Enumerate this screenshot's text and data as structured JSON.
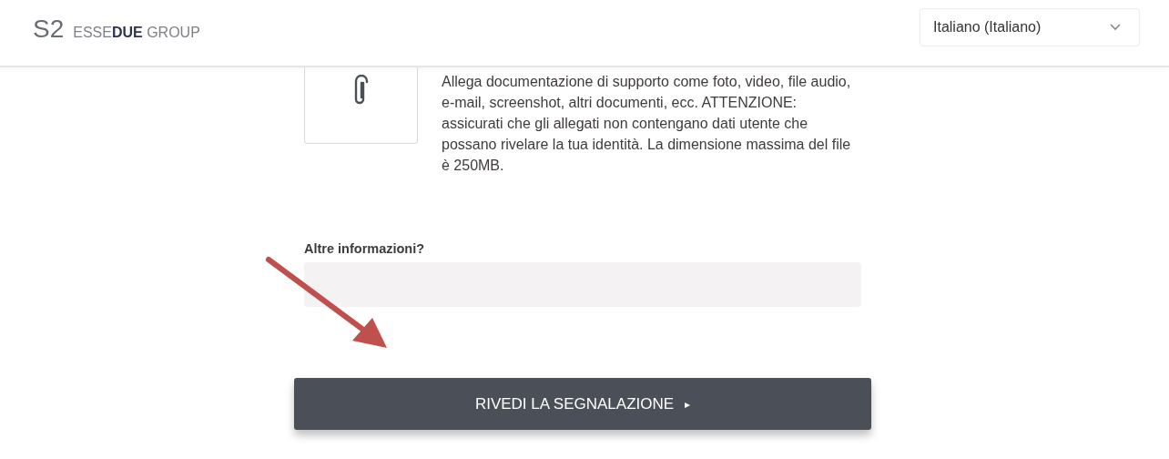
{
  "header": {
    "logo_mark": "S2",
    "logo_text": "ESSE**DUE** GROUP",
    "language": "Italiano (Italiano)"
  },
  "attachment": {
    "text": "Allega documentazione di supporto come foto, video, file audio, e-mail, screenshot, altri documenti, ecc. ATTENZIONE: assicurati che gli allegati non contengano dati utente che possano rivelare la tua identità. La dimensione massima del file è 250MB."
  },
  "other_info": {
    "label": "Altre informazioni?"
  },
  "review_button": {
    "label": "RIVEDI LA SEGNALAZIONE",
    "icon": "▸"
  }
}
